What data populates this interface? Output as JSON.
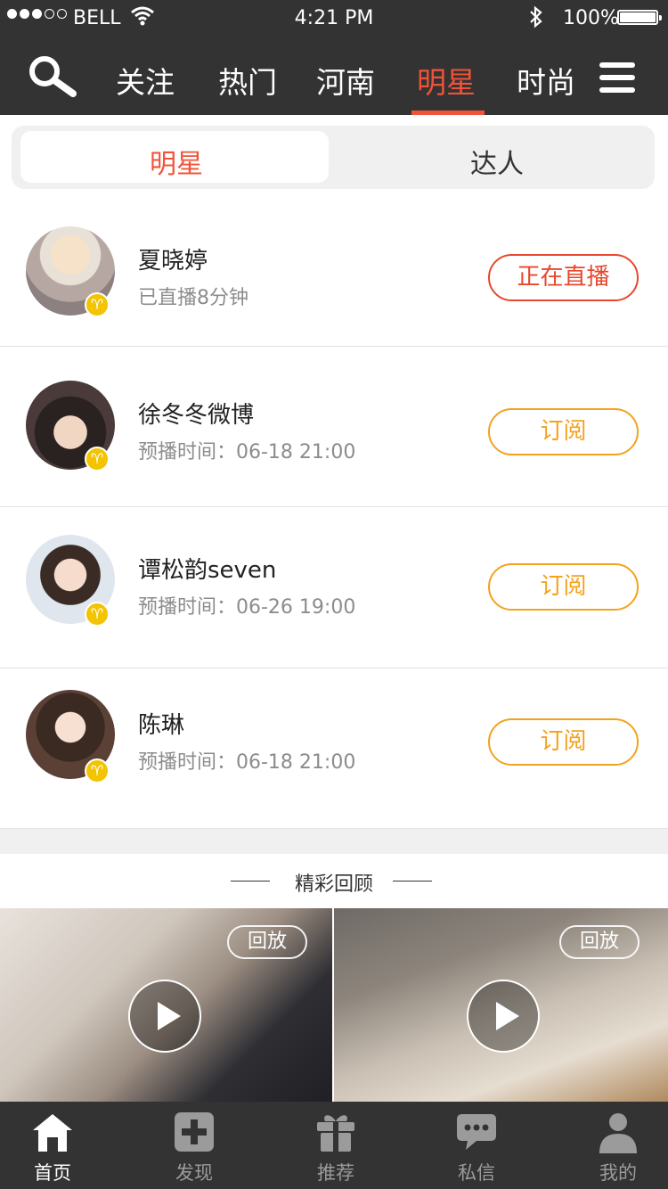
{
  "status": {
    "carrier": "BELL",
    "time": "4:21 PM",
    "battery": "100%"
  },
  "nav": {
    "tabs": [
      "关注",
      "热门",
      "河南",
      "明星",
      "时尚"
    ],
    "active_index": 3
  },
  "segment": {
    "options": [
      "明星",
      "达人"
    ],
    "active": "明星"
  },
  "anchors": [
    {
      "name": "夏晓婷",
      "status": "已直播8分钟",
      "action": "正在直播",
      "action_type": "live"
    },
    {
      "name": "徐冬冬微博",
      "status": "预播时间：06-18  21:00",
      "action": "订阅",
      "action_type": "subscribe"
    },
    {
      "name": "谭松韵seven",
      "status": "预播时间：06-26  19:00",
      "action": "订阅",
      "action_type": "subscribe"
    },
    {
      "name": "陈琳",
      "status": "预播时间：06-18  21:00",
      "action": "订阅",
      "action_type": "subscribe"
    }
  ],
  "review": {
    "title": "精彩回顾",
    "cards": [
      {
        "tag": "回放"
      },
      {
        "tag": "回放"
      }
    ]
  },
  "tabbar": {
    "items": [
      {
        "label": "首页",
        "icon": "home-icon"
      },
      {
        "label": "发现",
        "icon": "plus-square-icon"
      },
      {
        "label": "推荐",
        "icon": "gift-icon"
      },
      {
        "label": "私信",
        "icon": "chat-bubble-icon"
      },
      {
        "label": "我的",
        "icon": "user-icon"
      }
    ],
    "active_index": 0
  },
  "colors": {
    "accent": "#f0533a",
    "subscribe": "#f4a21d",
    "bar": "#333333",
    "badge": "#f3c400"
  }
}
